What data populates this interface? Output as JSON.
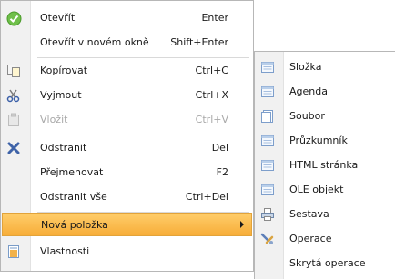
{
  "main_menu": {
    "items": [
      {
        "label": "Otevřít",
        "shortcut": "Enter",
        "icon": "check-circle-icon",
        "enabled": true
      },
      {
        "label": "Otevřít v novém okně",
        "shortcut": "Shift+Enter",
        "icon": "",
        "enabled": true
      },
      {
        "label": "Kopírovat",
        "shortcut": "Ctrl+C",
        "icon": "copy-icon",
        "enabled": true
      },
      {
        "label": "Vyjmout",
        "shortcut": "Ctrl+X",
        "icon": "scissors-icon",
        "enabled": true
      },
      {
        "label": "Vložit",
        "shortcut": "Ctrl+V",
        "icon": "paste-icon",
        "enabled": false
      },
      {
        "label": "Odstranit",
        "shortcut": "Del",
        "icon": "delete-icon",
        "enabled": true
      },
      {
        "label": "Přejmenovat",
        "shortcut": "F2",
        "icon": "",
        "enabled": true
      },
      {
        "label": "Odstranit vše",
        "shortcut": "Ctrl+Del",
        "icon": "",
        "enabled": true
      },
      {
        "label": "Nová položka",
        "shortcut": "",
        "icon": "",
        "enabled": true,
        "highlighted": true,
        "has_submenu": true
      },
      {
        "label": "Vlastnosti",
        "shortcut": "",
        "icon": "properties-icon",
        "enabled": true
      }
    ]
  },
  "submenu": {
    "items": [
      {
        "label": "Složka",
        "icon": "window-icon"
      },
      {
        "label": "Agenda",
        "icon": "window-icon"
      },
      {
        "label": "Soubor",
        "icon": "document-icon"
      },
      {
        "label": "Průzkumník",
        "icon": "window-icon"
      },
      {
        "label": "HTML stránka",
        "icon": "window-icon"
      },
      {
        "label": "OLE objekt",
        "icon": "window-icon"
      },
      {
        "label": "Sestava",
        "icon": "printer-icon"
      },
      {
        "label": "Operace",
        "icon": "tools-icon"
      },
      {
        "label": "Skrytá operace",
        "icon": ""
      }
    ]
  },
  "colors": {
    "highlight": "#f7ad39",
    "disabled_text": "#a8a8a8",
    "gutter": "#f1f1f1"
  }
}
